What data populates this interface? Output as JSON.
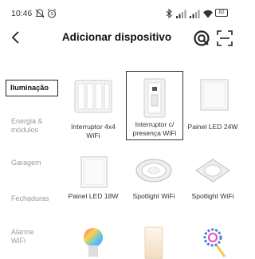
{
  "status": {
    "time": "10:46",
    "battery": "82"
  },
  "header": {
    "title": "Adicionar dispositivo"
  },
  "sidebar": {
    "items": [
      {
        "label": "Iluminação"
      },
      {
        "label": "Energia & módulos"
      },
      {
        "label": "Garagem"
      },
      {
        "label": "Fechaduras"
      },
      {
        "label": "Alarme WiFi"
      }
    ]
  },
  "devices": [
    {
      "label": "Interruptor 4x4 WiFi"
    },
    {
      "label": "Interruptor c/ presença WiFi"
    },
    {
      "label": "Painel LED 24W"
    },
    {
      "label": "Painel LED 18W"
    },
    {
      "label": "Spotlight WiFi"
    },
    {
      "label": "Spotlight WiFi"
    }
  ],
  "icons": [
    "mute-icon",
    "alarm-icon",
    "bluetooth-icon",
    "signal-icon",
    "wifi-icon",
    "battery-icon",
    "back-icon",
    "brand-icon",
    "scan-icon"
  ]
}
